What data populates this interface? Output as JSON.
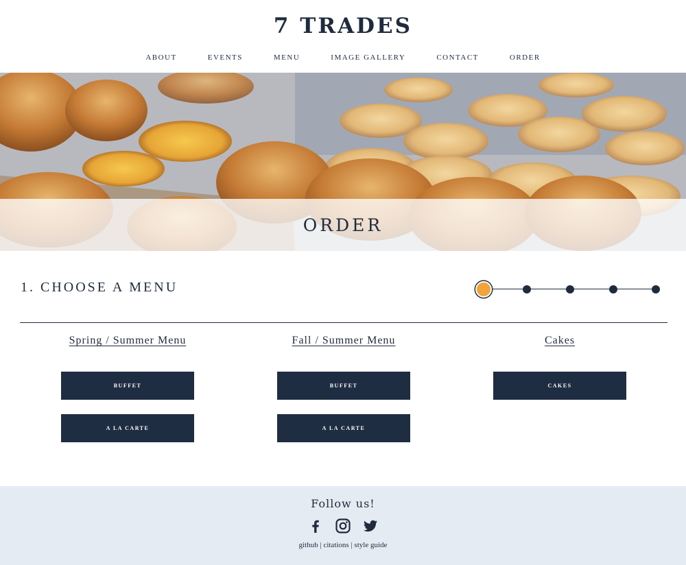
{
  "brand": "7 TRADES",
  "nav": [
    "ABOUT",
    "EVENTS",
    "MENU",
    "IMAGE GALLERY",
    "CONTACT",
    "ORDER"
  ],
  "hero": {
    "title": "ORDER"
  },
  "step": {
    "title": "1. CHOOSE A MENU",
    "current": 1,
    "total": 5
  },
  "menus": [
    {
      "heading": "Spring / Summer Menu",
      "buttons": [
        "BUFFET",
        "A LA CARTE"
      ]
    },
    {
      "heading": "Fall / Summer Menu",
      "buttons": [
        "BUFFET",
        "A LA CARTE"
      ]
    },
    {
      "heading": "Cakes",
      "buttons": [
        "CAKES"
      ]
    }
  ],
  "footer": {
    "follow": "Follow us!",
    "social_icons": [
      "facebook-icon",
      "instagram-icon",
      "twitter-icon"
    ],
    "links": [
      "github",
      "citations",
      "style guide"
    ],
    "separator": " | "
  },
  "colors": {
    "primary": "#1f2d42",
    "accent": "#f2a33a",
    "footer_bg": "#e5ebf2"
  }
}
